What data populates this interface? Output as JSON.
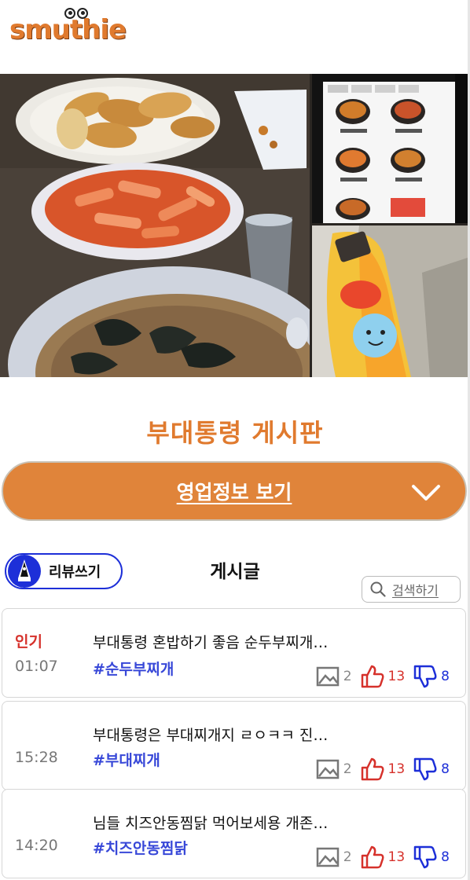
{
  "header": {
    "logo": "smuthie"
  },
  "board": {
    "title": "부대통령 게시판"
  },
  "info_bar": {
    "label": "영업정보 보기"
  },
  "toolbar": {
    "review_label": "리뷰쓰기",
    "posts_heading": "게시글",
    "search_label": "검색하기"
  },
  "posts": [
    {
      "badge": "인기",
      "time": "01:07",
      "title": "부대통령 혼밥하기 좋음 순두부찌개…",
      "tag": "#순두부찌개",
      "images": "2",
      "likes": "13",
      "dislikes": "8"
    },
    {
      "badge": "",
      "time": "15:28",
      "title": "부대통령은 부대찌개지 ㄹㅇㅋㅋ 진…",
      "tag": "#부대찌개",
      "images": "2",
      "likes": "13",
      "dislikes": "8"
    },
    {
      "badge": "",
      "time": "14:20",
      "title": "님들 치즈안동찜닭 먹어보세용 개존…",
      "tag": "#치즈안동찜닭",
      "images": "2",
      "likes": "13",
      "dislikes": "8"
    }
  ],
  "colors": {
    "brand_orange": "#e07a2e",
    "accent_blue": "#1d2fd8",
    "hot_red": "#d6312b"
  },
  "icons": {
    "review": "pen-icon",
    "search": "search-icon",
    "dropdown": "chevron-down-icon",
    "image_count": "image-icon",
    "like": "thumbs-up-icon",
    "dislike": "thumbs-down-icon"
  }
}
